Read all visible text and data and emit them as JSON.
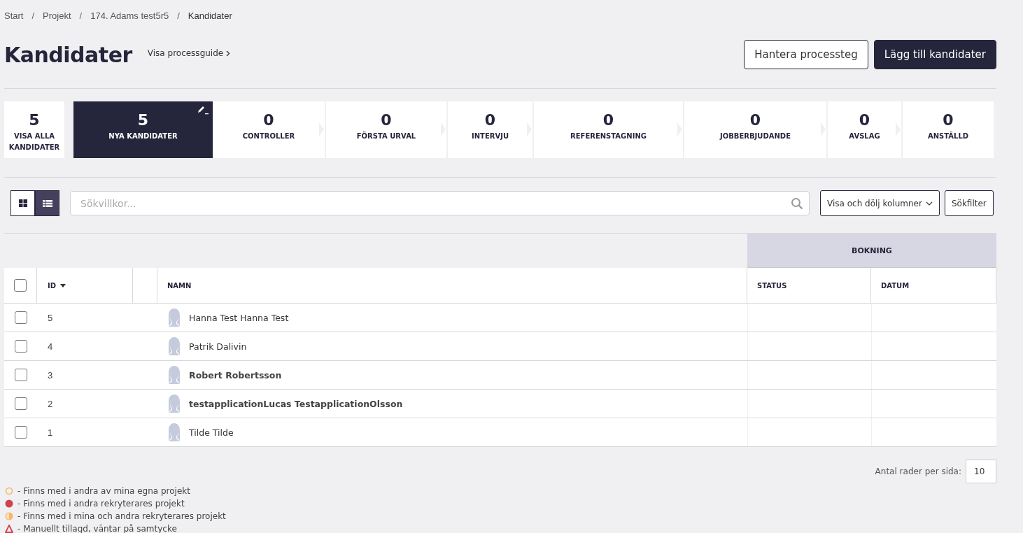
{
  "breadcrumbs": [
    {
      "label": "Start",
      "current": false
    },
    {
      "label": "Projekt",
      "current": false
    },
    {
      "label": "174. Adams test5r5",
      "current": false
    },
    {
      "label": "Kandidater",
      "current": true
    }
  ],
  "separator": "/",
  "title": "Kandidater",
  "guide_link": "Visa processguide",
  "buttons": [
    {
      "label": "Hantera processteg",
      "kind": "outline"
    },
    {
      "label": "Lägg till kandidater",
      "kind": "primary"
    }
  ],
  "stages": [
    {
      "count": "5",
      "label": "VISA ALLA KANDIDATER",
      "selected": false,
      "kind": "all"
    },
    {
      "count": "5",
      "label": "NYA KANDIDATER",
      "selected": true,
      "kind": "step"
    },
    {
      "count": "0",
      "label": "CONTROLLER",
      "selected": false,
      "kind": "step"
    },
    {
      "count": "0",
      "label": "FÖRSTA URVAL",
      "selected": false,
      "kind": "step"
    },
    {
      "count": "0",
      "label": "INTERVJU",
      "selected": false,
      "kind": "step"
    },
    {
      "count": "0",
      "label": "REFERENSTAGNING",
      "selected": false,
      "kind": "step"
    },
    {
      "count": "0",
      "label": "JOBBERBJUDANDE",
      "selected": false,
      "kind": "step"
    },
    {
      "count": "0",
      "label": "AVSLAG",
      "selected": false,
      "kind": "step"
    },
    {
      "count": "0",
      "label": "ANSTÄLLD",
      "selected": false,
      "kind": "step"
    }
  ],
  "view_toggle": [
    {
      "kind": "grid",
      "selected": false
    },
    {
      "kind": "list",
      "selected": true
    }
  ],
  "search": {
    "placeholder": "Sökvillkor..."
  },
  "columns_button": "Visa och dölj kolumner",
  "filter_button": "Sökfilter",
  "table": {
    "group_header": "BOKNING",
    "columns": [
      {
        "label": "ID",
        "sorted": true
      },
      {
        "label": "NAMN",
        "sorted": false
      },
      {
        "label": "STATUS",
        "sorted": false
      },
      {
        "label": "DATUM",
        "sorted": false
      }
    ],
    "header_checked": false,
    "rows": [
      {
        "checked": false,
        "id": "5",
        "name": "Hanna Test Hanna Test",
        "unread": false
      },
      {
        "checked": false,
        "id": "4",
        "name": "Patrik Dalivin",
        "unread": false
      },
      {
        "checked": false,
        "id": "3",
        "name": "Robert Robertsson",
        "unread": true
      },
      {
        "checked": false,
        "id": "2",
        "name": "testapplicationLucas TestapplicationOlsson",
        "unread": true
      },
      {
        "checked": false,
        "id": "1",
        "name": "Tilde Tilde",
        "unread": false
      }
    ]
  },
  "rows_per_page": {
    "label": "Antal rader per sida:",
    "value": "10"
  },
  "legend": [
    {
      "kind": "ring",
      "color": "#f5b86a",
      "text": "- Finns med i andra av mina egna projekt"
    },
    {
      "kind": "dot",
      "color": "#d0424c",
      "text": "- Finns med i andra rekryterares projekt"
    },
    {
      "kind": "half",
      "color": "#f5b86a",
      "text": "- Finns med i mina och andra rekryterares projekt"
    },
    {
      "kind": "warning",
      "color": "#d0424c",
      "text": "- Manuellt tillagd, väntar på samtycke"
    }
  ]
}
